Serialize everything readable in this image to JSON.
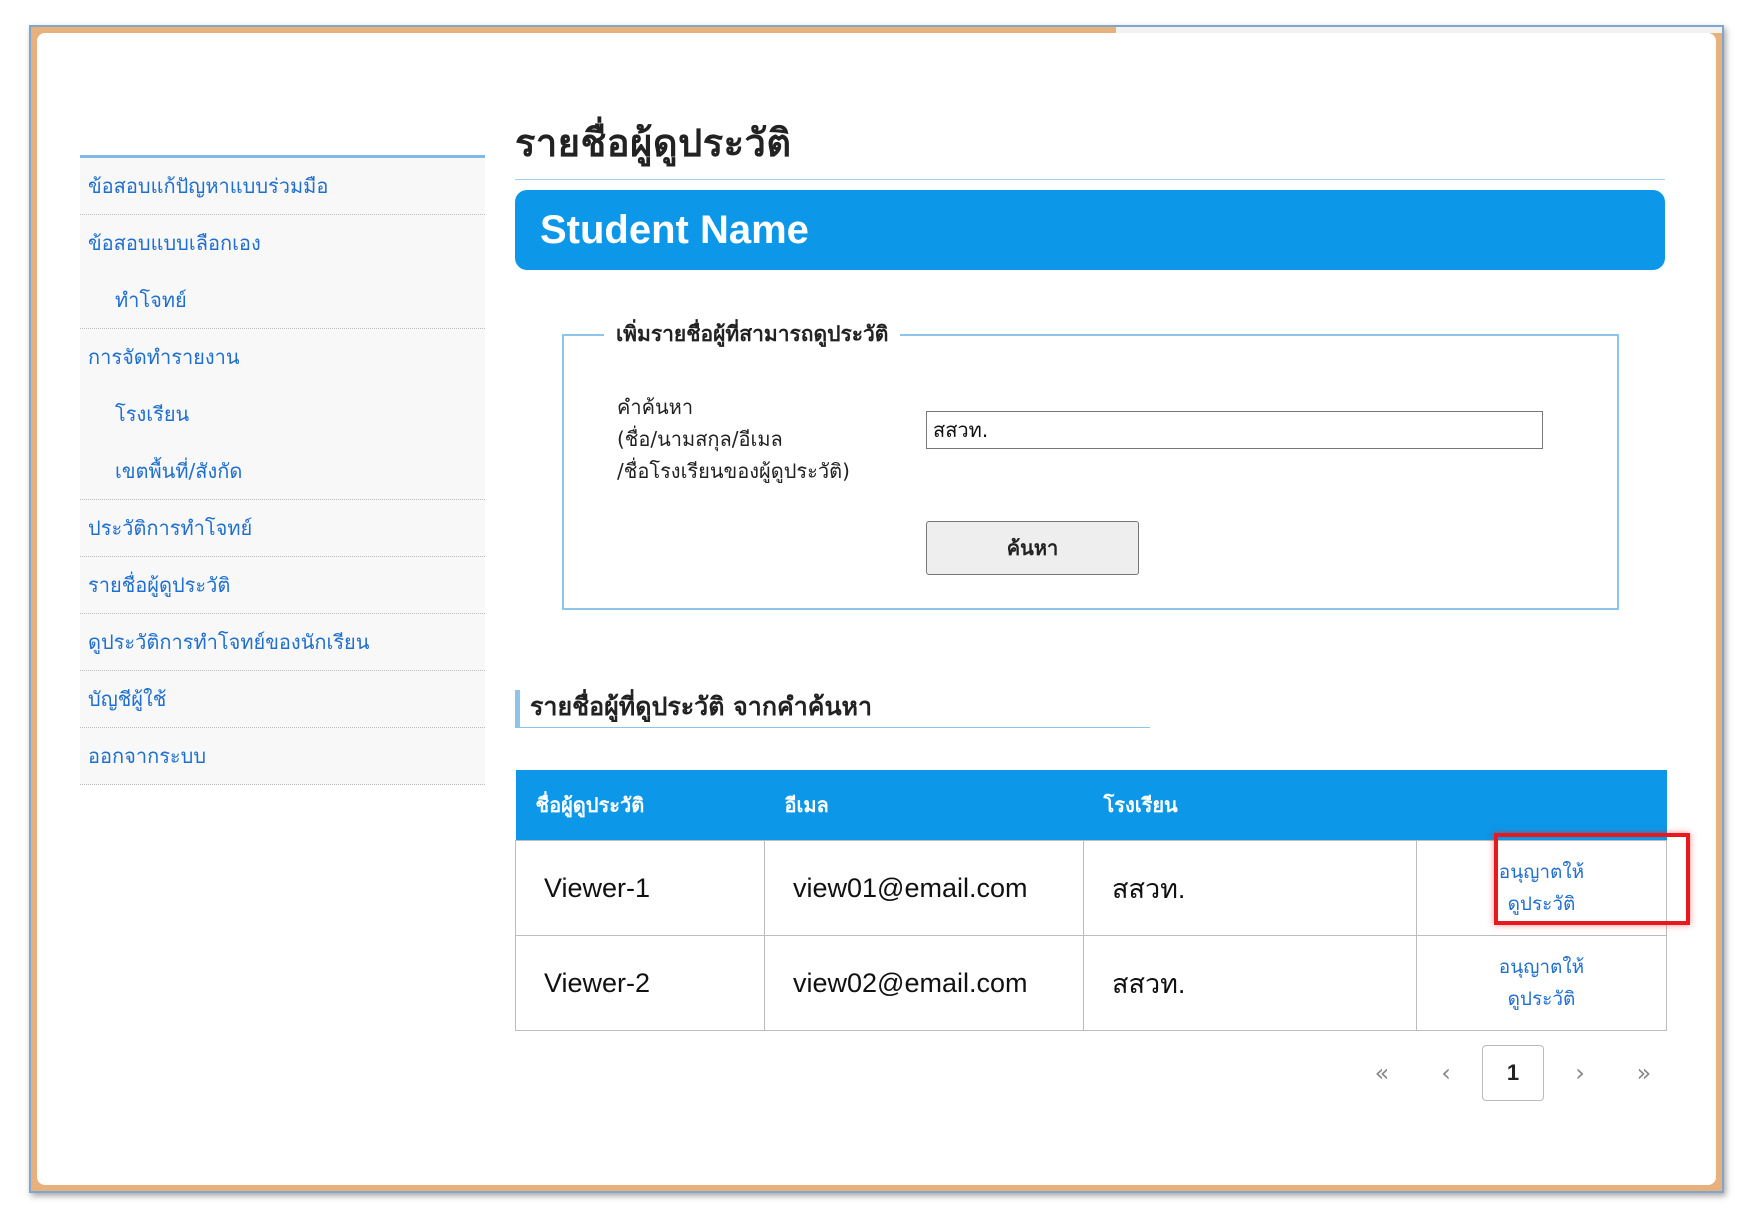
{
  "sidebar": {
    "items": [
      {
        "label": "ข้อสอบแก้ปัญหาแบบร่วมมือ"
      },
      {
        "label": "ข้อสอบแบบเลือกเอง"
      },
      {
        "label": "ทำโจทย์"
      },
      {
        "label": "การจัดทำรายงาน"
      },
      {
        "label": "โรงเรียน"
      },
      {
        "label": "เขตพื้นที่/สังกัด"
      },
      {
        "label": "ประวัติการทำโจทย์"
      },
      {
        "label": "รายชื่อผู้ดูประวัติ"
      },
      {
        "label": "ดูประวัติการทำโจทย์ของนักเรียน"
      },
      {
        "label": "บัญชีผู้ใช้"
      },
      {
        "label": "ออกจากระบบ"
      }
    ]
  },
  "page": {
    "title": "รายชื่อผู้ดูประวัติ",
    "banner": "Student Name"
  },
  "search": {
    "legend": "เพิ่มรายชื่อผู้ที่สามารถดูประวัติ",
    "label_line1": "คำค้นหา",
    "label_line2": "(ชื่อ/นามสกุล/อีเมล",
    "label_line3": "/ชื่อโรงเรียนของผู้ดูประวัติ)",
    "value": "สสวท.",
    "button": "ค้นหา"
  },
  "results": {
    "heading": "รายชื่อผู้ที่ดูประวัติ จากคำค้นหา",
    "columns": [
      "ชื่อผู้ดูประวัติ",
      "อีเมล",
      "โรงเรียน",
      ""
    ],
    "rows": [
      {
        "name": "Viewer-1",
        "email": "view01@email.com",
        "school": "สสวท.",
        "action_line1": "อนุญาตให้",
        "action_line2": "ดูประวัติ"
      },
      {
        "name": "Viewer-2",
        "email": "view02@email.com",
        "school": "สสวท.",
        "action_line1": "อนุญาตให้",
        "action_line2": "ดูประวัติ"
      }
    ]
  },
  "pagination": {
    "first": "«",
    "prev": "‹",
    "current": "1",
    "next": "›",
    "last": "»"
  },
  "colors": {
    "accent": "#0c97e8",
    "link": "#1e6fd0",
    "highlight": "#e8191c"
  }
}
